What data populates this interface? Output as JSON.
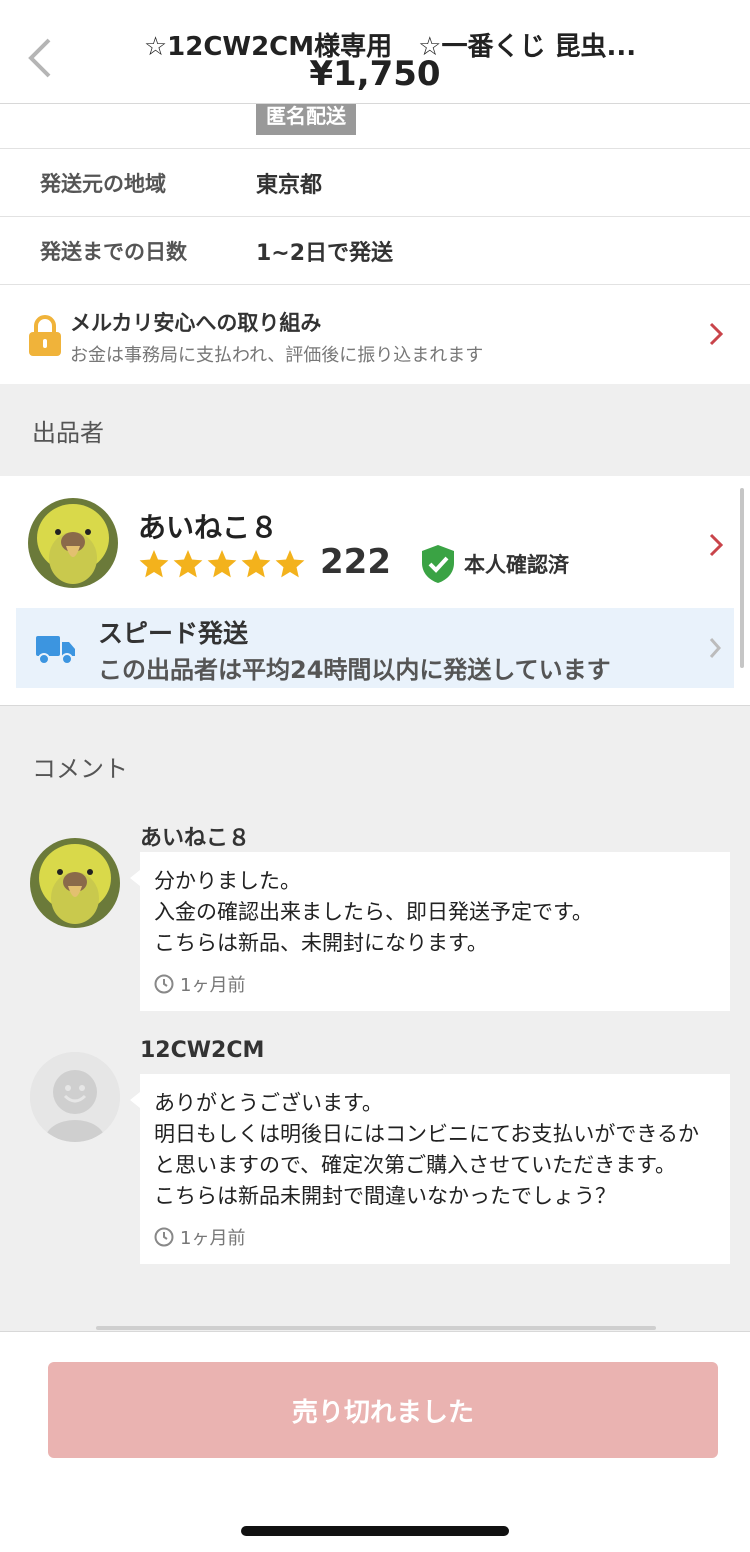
{
  "header": {
    "title": "☆12CW2CM様専用　☆一番くじ 昆虫...",
    "price": "¥1,750"
  },
  "shipping": {
    "anonymous_badge": "匿名配送",
    "rows": [
      {
        "label": "発送元の地域",
        "value": "東京都"
      },
      {
        "label": "発送までの日数",
        "value": "1~2日で発送"
      }
    ]
  },
  "safety": {
    "title": "メルカリ安心への取り組み",
    "subtitle": "お金は事務局に支払われ、評価後に振り込まれます"
  },
  "seller_section": {
    "title": "出品者",
    "name": "あいねこ８",
    "rating_stars": 5,
    "rating_count": "222",
    "verified_label": "本人確認済",
    "speed_title": "スピード発送",
    "speed_subtitle": "この出品者は平均24時間以内に発送しています"
  },
  "comments_section": {
    "title": "コメント",
    "items": [
      {
        "author": "あいねこ８",
        "text": "分かりました。\n入金の確認出来ましたら、即日発送予定です。\nこちらは新品、未開封になります。",
        "time": "1ヶ月前"
      },
      {
        "author": "12CW2CM",
        "text": "ありがとうございます。\n明日もしくは明後日にはコンビニにてお支払いができるかと思いますので、確定次第ご購入させていただきます。\nこちらは新品未開封で間違いなかったでしょう？",
        "time": "1ヶ月前"
      }
    ]
  },
  "bottom": {
    "sold_out_label": "売り切れました"
  },
  "colors": {
    "accent_red": "#c9444a",
    "star_yellow": "#f3b21c",
    "verified_green": "#3aa344",
    "truck_blue": "#3c95e0",
    "soldout_bg": "#eab3b1"
  }
}
